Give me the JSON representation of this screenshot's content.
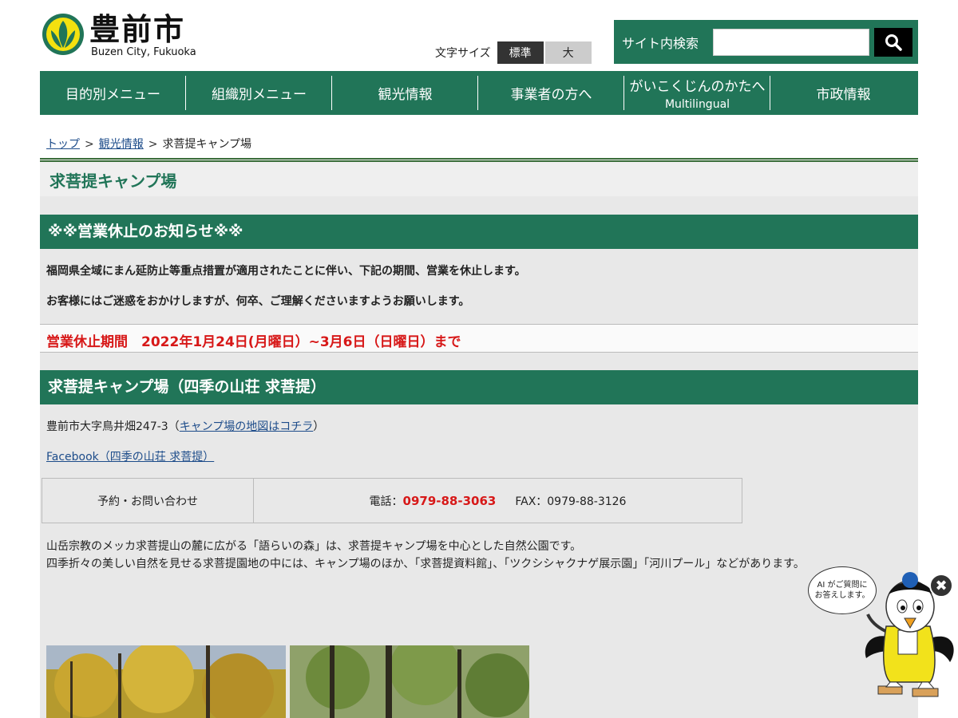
{
  "header": {
    "logo_jp": "豊前市",
    "logo_en": "Buzen City, Fukuoka",
    "font_size_label": "文字サイズ",
    "font_size_standard": "標準",
    "font_size_large": "大",
    "search_label": "サイト内検索",
    "search_placeholder": "",
    "brand_color": "#217558"
  },
  "nav": {
    "items": [
      {
        "label": "目的別メニュー",
        "sub": ""
      },
      {
        "label": "組織別メニュー",
        "sub": ""
      },
      {
        "label": "観光情報",
        "sub": ""
      },
      {
        "label": "事業者の方へ",
        "sub": ""
      },
      {
        "label": "がいこくじんのかたへ",
        "sub": "Multilingual"
      },
      {
        "label": "市政情報",
        "sub": ""
      }
    ]
  },
  "breadcrumb": {
    "top": "トップ",
    "sep": ">",
    "tourism": "観光情報",
    "current": "求菩提キャンプ場"
  },
  "page": {
    "title": "求菩提キャンプ場",
    "notice_heading": "※※営業休止のお知らせ※※",
    "notice_line1": "福岡県全域にまん延防止等重点措置が適用されたことに伴い、下記の期間、営業を休止します。",
    "notice_line2": "お客様にはご迷惑をおかけしますが、何卒、ご理解くださいますようお願いします。",
    "closure_period": "営業休止期間　2022年1月24日(月曜日）~3月6日（日曜日）まで",
    "camp_heading": "求菩提キャンプ場（四季の山荘 求菩提）",
    "address": "豊前市大字鳥井畑247-3（",
    "map_link": "キャンプ場の地図はコチラ",
    "address_close": "）",
    "facebook_link": "Facebook（四季の山荘 求菩提）",
    "contact_label": "予約・お問い合わせ",
    "tel_label": "電話：",
    "tel_number": "0979-88-3063",
    "fax": "FAX：0979-88-3126",
    "desc_line1": "山岳宗教のメッカ求菩提山の麓に広がる「語らいの森」は、求菩提キャンプ場を中心とした自然公園です。",
    "desc_line2": "四季折々の美しい自然を見せる求菩提園地の中には、キャンプ場のほか、「求菩提資料館」、「ツクシシャクナゲ展示園」「河川プール」などがあります。",
    "alert_color": "#d71818"
  },
  "chatbot": {
    "bubble_line1": "AI がご質問に",
    "bubble_line2": "お答えします。",
    "close_icon": "close-icon"
  }
}
